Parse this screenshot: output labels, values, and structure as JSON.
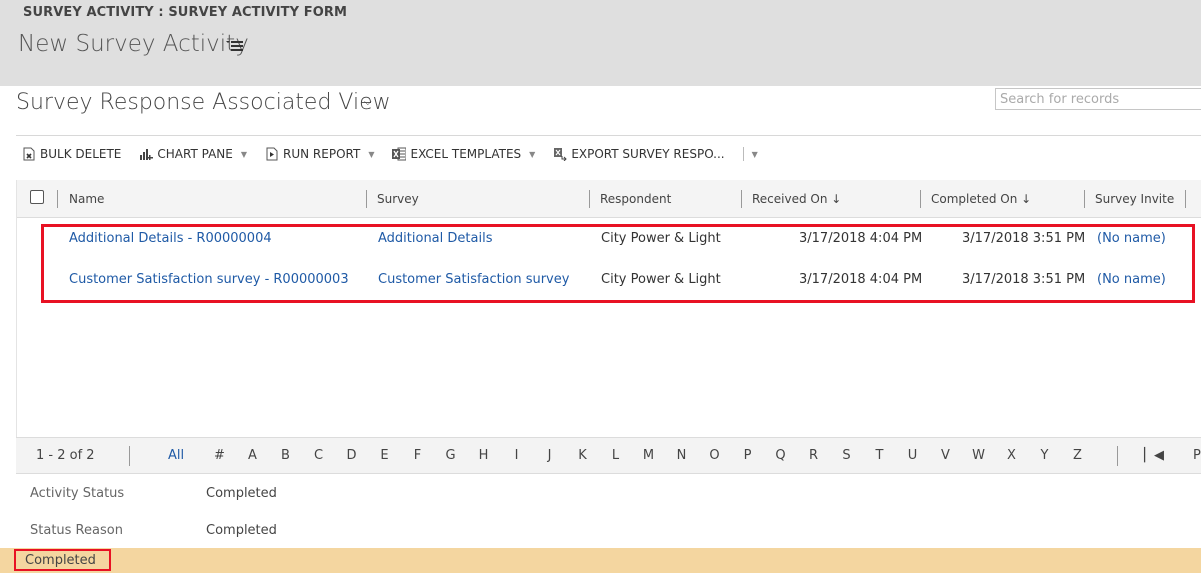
{
  "header": {
    "breadcrumb": "SURVEY ACTIVITY : SURVEY ACTIVITY FORM",
    "title": "New Survey Activity",
    "title_menu_icon": "list-menu-icon"
  },
  "view": {
    "title": "Survey Response Associated View",
    "chevron": "⌄",
    "search_placeholder": "Search for records"
  },
  "toolbar": {
    "items": [
      {
        "label": "BULK DELETE",
        "icon": "bulk-delete-icon",
        "has_caret": false
      },
      {
        "label": "CHART PANE",
        "icon": "chart-pane-icon",
        "has_caret": true
      },
      {
        "label": "RUN REPORT",
        "icon": "run-report-icon",
        "has_caret": true
      },
      {
        "label": "EXCEL TEMPLATES",
        "icon": "excel-icon",
        "has_caret": true
      },
      {
        "label": "EXPORT SURVEY RESPO...",
        "icon": "export-excel-icon",
        "has_caret": false
      }
    ],
    "caret": "▼",
    "more": "▼"
  },
  "grid": {
    "columns": [
      {
        "label": "Name"
      },
      {
        "label": "Survey"
      },
      {
        "label": "Respondent"
      },
      {
        "label": "Received On ↓"
      },
      {
        "label": "Completed On ↓"
      },
      {
        "label": "Survey Invite"
      }
    ],
    "rows": [
      {
        "name": "Additional Details - R00000004",
        "survey": "Additional Details",
        "respondent": "City Power & Light",
        "received_on": "3/17/2018 4:04 PM",
        "completed_on": "3/17/2018 3:51 PM",
        "survey_invite": "(No name)"
      },
      {
        "name": "Customer Satisfaction survey - R00000003",
        "survey": "Customer Satisfaction survey",
        "respondent": "City Power & Light",
        "received_on": "3/17/2018 4:04 PM",
        "completed_on": "3/17/2018 3:51 PM",
        "survey_invite": "(No name)"
      }
    ]
  },
  "pager": {
    "count": "1 - 2 of 2",
    "all": "All",
    "letters": [
      "#",
      "A",
      "B",
      "C",
      "D",
      "E",
      "F",
      "G",
      "H",
      "I",
      "J",
      "K",
      "L",
      "M",
      "N",
      "O",
      "P",
      "Q",
      "R",
      "S",
      "T",
      "U",
      "V",
      "W",
      "X",
      "Y",
      "Z"
    ],
    "first": "K◂",
    "prev": "P"
  },
  "fields": [
    {
      "label": "Activity Status",
      "value": "Completed"
    },
    {
      "label": "Status Reason",
      "value": "Completed"
    }
  ],
  "status_bar": {
    "text": "Completed"
  },
  "colors": {
    "link": "#1f5aa6",
    "highlight": "#e81123",
    "status_bar": "#f4d6a0",
    "header_bg": "#dfdfdf"
  }
}
